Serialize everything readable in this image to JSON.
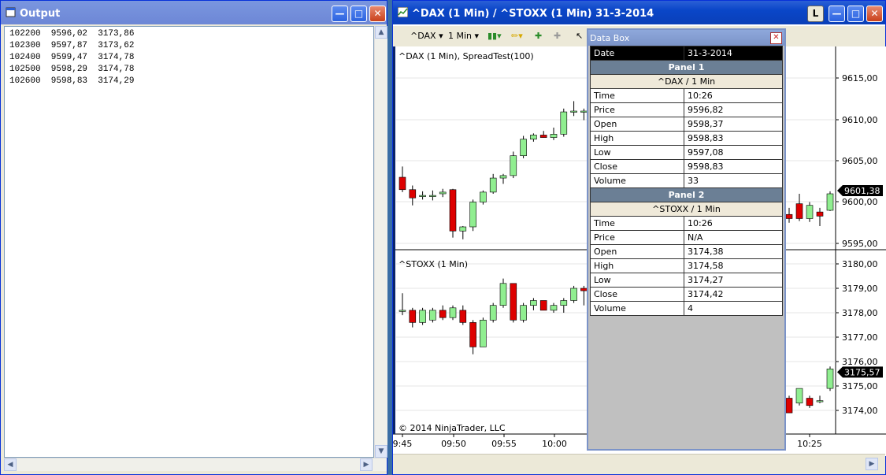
{
  "output_window": {
    "title": "Output",
    "lines": [
      "102200  9596,02  3173,86",
      "102300  9597,87  3173,62",
      "102400  9599,47  3174,78",
      "102500  9598,29  3174,78",
      "102600  9598,83  3174,29"
    ]
  },
  "chart_window": {
    "title": "^DAX (1 Min) / ^STOXX (1 Min)  31-3-2014",
    "toolbar": {
      "instrument": "^DAX",
      "interval": "1 Min"
    },
    "panel1_label": "^DAX (1 Min), SpreadTest(100)",
    "panel2_label": "^STOXX (1 Min)",
    "copyright": "© 2014 NinjaTrader, LLC",
    "panel1_last_price": "9601,38",
    "panel2_last_price": "3175,57",
    "colors": {
      "up": "#90ee90",
      "down": "#dd0000",
      "wick": "#000000"
    }
  },
  "data_box": {
    "title": "Data Box",
    "date_label": "Date",
    "date_value": "31-3-2014",
    "panels": [
      {
        "name": "Panel 1",
        "instrument": "^DAX / 1 Min",
        "rows": [
          {
            "k": "Time",
            "v": "10:26"
          },
          {
            "k": "Price",
            "v": "9596,82"
          },
          {
            "k": "Open",
            "v": "9598,37"
          },
          {
            "k": "High",
            "v": "9598,83"
          },
          {
            "k": "Low",
            "v": "9597,08"
          },
          {
            "k": "Close",
            "v": "9598,83"
          },
          {
            "k": "Volume",
            "v": "33"
          }
        ]
      },
      {
        "name": "Panel 2",
        "instrument": "^STOXX / 1 Min",
        "rows": [
          {
            "k": "Time",
            "v": "10:26"
          },
          {
            "k": "Price",
            "v": "N/A"
          },
          {
            "k": "Open",
            "v": "3174,38"
          },
          {
            "k": "High",
            "v": "3174,58"
          },
          {
            "k": "Low",
            "v": "3174,27"
          },
          {
            "k": "Close",
            "v": "3174,42"
          },
          {
            "k": "Volume",
            "v": "4"
          }
        ]
      }
    ]
  },
  "chart_data": [
    {
      "type": "candlestick",
      "title": "^DAX (1 Min), SpreadTest(100)",
      "y_ticks": [
        "9615,00",
        "9610,00",
        "9605,00",
        "9600,00",
        "9595,00"
      ],
      "ylim": [
        9594,
        9618
      ],
      "candles": [
        {
          "o": 9603.0,
          "h": 9604.3,
          "l": 9601.2,
          "c": 9601.5
        },
        {
          "o": 9601.5,
          "h": 9602.0,
          "l": 9599.6,
          "c": 9600.5
        },
        {
          "o": 9600.8,
          "h": 9601.3,
          "l": 9600.3,
          "c": 9600.8
        },
        {
          "o": 9600.8,
          "h": 9601.4,
          "l": 9600.2,
          "c": 9600.8
        },
        {
          "o": 9601.0,
          "h": 9601.6,
          "l": 9600.6,
          "c": 9601.2
        },
        {
          "o": 9601.5,
          "h": 9601.6,
          "l": 9595.7,
          "c": 9596.5
        },
        {
          "o": 9596.5,
          "h": 9597.1,
          "l": 9595.5,
          "c": 9597.0
        },
        {
          "o": 9597.0,
          "h": 9600.3,
          "l": 9596.5,
          "c": 9600.0
        },
        {
          "o": 9600.0,
          "h": 9601.4,
          "l": 9599.7,
          "c": 9601.2
        },
        {
          "o": 9601.2,
          "h": 9603.4,
          "l": 9601.0,
          "c": 9602.9
        },
        {
          "o": 9602.9,
          "h": 9603.4,
          "l": 9602.2,
          "c": 9603.2
        },
        {
          "o": 9603.2,
          "h": 9606.1,
          "l": 9602.9,
          "c": 9605.6
        },
        {
          "o": 9605.6,
          "h": 9608.0,
          "l": 9605.3,
          "c": 9607.6
        },
        {
          "o": 9607.6,
          "h": 9608.3,
          "l": 9607.3,
          "c": 9608.1
        },
        {
          "o": 9608.1,
          "h": 9608.6,
          "l": 9607.8,
          "c": 9607.8
        },
        {
          "o": 9607.8,
          "h": 9609.0,
          "l": 9607.5,
          "c": 9608.2
        },
        {
          "o": 9608.2,
          "h": 9611.3,
          "l": 9607.9,
          "c": 9610.9
        },
        {
          "o": 9610.9,
          "h": 9612.2,
          "l": 9610.4,
          "c": 9611.0
        },
        {
          "o": 9611.0,
          "h": 9611.3,
          "l": 9609.9,
          "c": 9611.0
        },
        {
          "o": 9611.0,
          "h": 9611.3,
          "l": 9609.7,
          "c": 9610.0
        },
        {
          "o": 9598.5,
          "h": 9599.3,
          "l": 9597.5,
          "c": 9598.0
        },
        {
          "o": 9599.8,
          "h": 9601.0,
          "l": 9597.7,
          "c": 9598.0
        },
        {
          "o": 9598.0,
          "h": 9600.0,
          "l": 9597.6,
          "c": 9599.6
        },
        {
          "o": 9598.8,
          "h": 9599.3,
          "l": 9597.1,
          "c": 9598.3
        },
        {
          "o": 9599.0,
          "h": 9601.3,
          "l": 9598.9,
          "c": 9601.0
        }
      ]
    },
    {
      "type": "candlestick",
      "title": "^STOXX (1 Min)",
      "y_ticks": [
        "3180,00",
        "3179,00",
        "3178,00",
        "3177,00",
        "3176,00",
        "3175,00",
        "3174,00"
      ],
      "x_ticks": [
        "9:45",
        "09:50",
        "09:55",
        "10:00",
        "10:25"
      ],
      "ylim": [
        3173.6,
        3180.4
      ],
      "candles": [
        {
          "o": 3178.1,
          "h": 3178.8,
          "l": 3177.9,
          "c": 3178.1
        },
        {
          "o": 3178.1,
          "h": 3178.2,
          "l": 3177.4,
          "c": 3177.6
        },
        {
          "o": 3177.6,
          "h": 3178.2,
          "l": 3177.5,
          "c": 3178.1
        },
        {
          "o": 3177.7,
          "h": 3178.2,
          "l": 3177.6,
          "c": 3178.1
        },
        {
          "o": 3178.1,
          "h": 3178.3,
          "l": 3177.7,
          "c": 3177.8
        },
        {
          "o": 3177.8,
          "h": 3178.3,
          "l": 3177.7,
          "c": 3178.2
        },
        {
          "o": 3178.1,
          "h": 3178.3,
          "l": 3177.5,
          "c": 3177.6
        },
        {
          "o": 3177.6,
          "h": 3177.7,
          "l": 3176.3,
          "c": 3176.6
        },
        {
          "o": 3176.6,
          "h": 3177.8,
          "l": 3176.6,
          "c": 3177.7
        },
        {
          "o": 3177.7,
          "h": 3178.4,
          "l": 3177.6,
          "c": 3178.3
        },
        {
          "o": 3178.3,
          "h": 3179.4,
          "l": 3178.2,
          "c": 3179.2
        },
        {
          "o": 3179.2,
          "h": 3179.2,
          "l": 3177.6,
          "c": 3177.7
        },
        {
          "o": 3177.7,
          "h": 3178.4,
          "l": 3177.6,
          "c": 3178.3
        },
        {
          "o": 3178.3,
          "h": 3178.6,
          "l": 3178.1,
          "c": 3178.5
        },
        {
          "o": 3178.5,
          "h": 3178.5,
          "l": 3178.1,
          "c": 3178.1
        },
        {
          "o": 3178.1,
          "h": 3178.4,
          "l": 3178.0,
          "c": 3178.3
        },
        {
          "o": 3178.3,
          "h": 3178.6,
          "l": 3178.0,
          "c": 3178.5
        },
        {
          "o": 3178.5,
          "h": 3179.1,
          "l": 3178.4,
          "c": 3179.0
        },
        {
          "o": 3179.0,
          "h": 3179.1,
          "l": 3178.3,
          "c": 3178.9
        },
        {
          "o": 3178.9,
          "h": 3179.0,
          "l": 3178.3,
          "c": 3178.4
        },
        {
          "o": 3174.5,
          "h": 3174.6,
          "l": 3173.9,
          "c": 3173.9
        },
        {
          "o": 3174.3,
          "h": 3174.9,
          "l": 3174.2,
          "c": 3174.9
        },
        {
          "o": 3174.5,
          "h": 3174.6,
          "l": 3174.1,
          "c": 3174.2
        },
        {
          "o": 3174.4,
          "h": 3174.6,
          "l": 3174.3,
          "c": 3174.4
        },
        {
          "o": 3174.9,
          "h": 3175.8,
          "l": 3174.8,
          "c": 3175.7
        }
      ]
    }
  ]
}
